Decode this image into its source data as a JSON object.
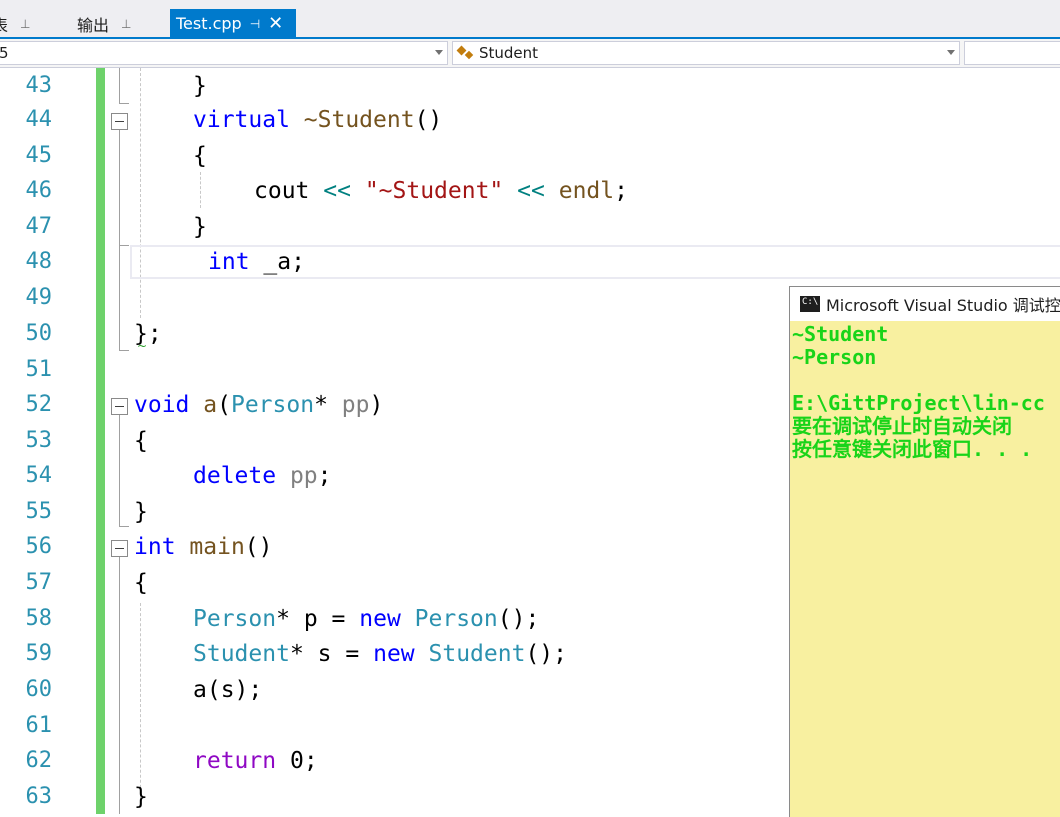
{
  "tabs": [
    {
      "label": "表",
      "pin": "⊥",
      "active": false
    },
    {
      "label": "输出",
      "pin": "⊥",
      "active": false
    },
    {
      "label": "Test.cpp",
      "pin": "⊣",
      "close": "✕",
      "active": true
    }
  ],
  "navbar": {
    "scope_value": "5",
    "member_value": "Student"
  },
  "editor": {
    "lines": [
      {
        "n": "43"
      },
      {
        "n": "44"
      },
      {
        "n": "45"
      },
      {
        "n": "46"
      },
      {
        "n": "47"
      },
      {
        "n": "48"
      },
      {
        "n": "49"
      },
      {
        "n": "50"
      },
      {
        "n": "51"
      },
      {
        "n": "52"
      },
      {
        "n": "53"
      },
      {
        "n": "54"
      },
      {
        "n": "55"
      },
      {
        "n": "56"
      },
      {
        "n": "57"
      },
      {
        "n": "58"
      },
      {
        "n": "59"
      },
      {
        "n": "60"
      },
      {
        "n": "61"
      },
      {
        "n": "62"
      },
      {
        "n": "63"
      }
    ],
    "tokens": {
      "brace_close": "}",
      "brace_open": "{",
      "virtual": "virtual",
      "dtor": "~Student",
      "parens": "()",
      "cout": "cout",
      "shift": "<<",
      "str": "\"~Student\"",
      "endl": "endl",
      "semi": ";",
      "int": "int",
      "member_a": "_a;",
      "class_end": "};",
      "void": "void",
      "fn_a": "a",
      "lparen": "(",
      "Person": "Person",
      "star": "*",
      "pp": "pp",
      "rparen": ")",
      "delete": "delete",
      "main": "main",
      "p": "p",
      "eq": "=",
      "new": "new",
      "call_end": "();",
      "Student": "Student",
      "s": "s",
      "call_a": "a(s);",
      "return": "return",
      "zero": "0",
      "semi2": ";"
    }
  },
  "console": {
    "title": "Microsoft Visual Studio 调试控制台",
    "lines": [
      "~Student",
      "~Person",
      "",
      "E:\\GittProject\\lin-cc",
      "要在调试停止时自动关闭",
      "按任意键关闭此窗口. . ."
    ]
  }
}
